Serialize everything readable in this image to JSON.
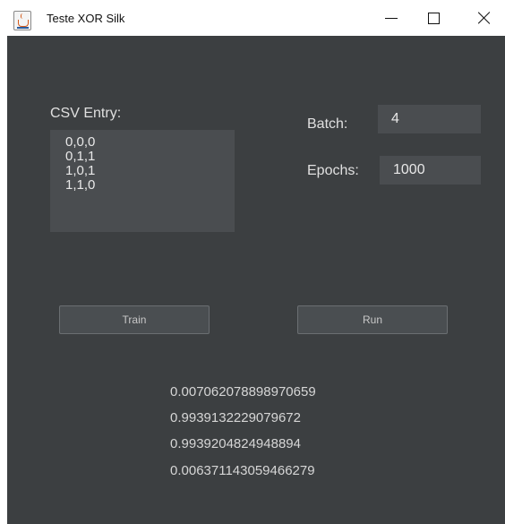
{
  "window": {
    "title": "Teste XOR Silk",
    "icons": {
      "app": "java-cup-icon",
      "minimize": "minimize-icon",
      "maximize": "maximize-icon",
      "close": "close-icon"
    }
  },
  "form": {
    "csv_label": "CSV Entry:",
    "csv_lines": [
      "0,0,0",
      "0,1,1",
      "1,0,1",
      "1,1,0"
    ],
    "batch_label": "Batch:",
    "batch_value": "4",
    "epochs_label": "Epochs:",
    "epochs_value": "1000"
  },
  "buttons": {
    "train": "Train",
    "run": "Run"
  },
  "results": [
    "0.007062078898970659",
    "0.9939132229079672",
    "0.9939204824948894",
    "0.006371143059466279"
  ],
  "colors": {
    "background": "#3c3f41",
    "field": "#4a4d50",
    "text": "#e0e0e0"
  }
}
